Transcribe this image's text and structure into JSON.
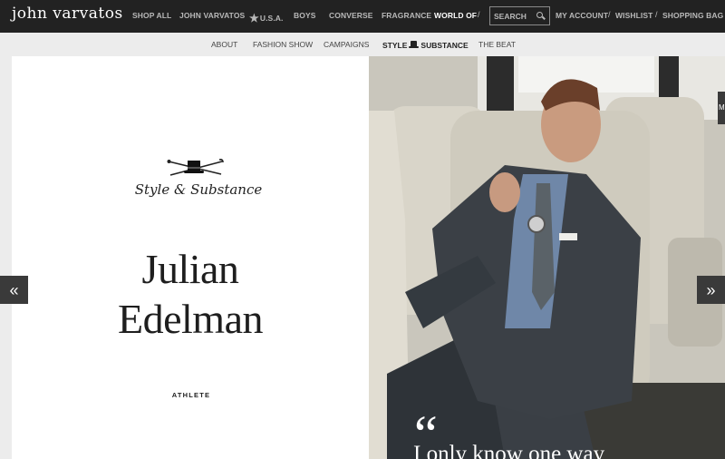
{
  "brand": {
    "logo_text": "john varvatos"
  },
  "topnav": {
    "items": [
      {
        "label": "SHOP ALL"
      },
      {
        "label": "JOHN VARVATOS"
      },
      {
        "label": "U.S.A."
      },
      {
        "label": "BOYS"
      },
      {
        "label": "CONVERSE"
      },
      {
        "label": "FRAGRANCE"
      },
      {
        "label": "WORLD OF"
      }
    ],
    "separator": "/",
    "search_placeholder": "SEARCH",
    "account_label": "MY ACCOUNT",
    "wishlist_label": "WISHLIST",
    "bag_label": "SHOPPING BAG"
  },
  "subnav": {
    "items": [
      {
        "label": "ABOUT"
      },
      {
        "label": "FASHION SHOW"
      },
      {
        "label": "CAMPAIGNS"
      }
    ],
    "style_label": "STYLE",
    "substance_label": "SUBSTANCE",
    "beat_label": "THE BEAT"
  },
  "feature": {
    "series_title": "Style & Substance",
    "first_name": "Julian",
    "last_name": "Edelman",
    "role": "ATHLETE",
    "quote_mark": "“",
    "quote_text": "I only know one way"
  },
  "carousel": {
    "prev_icon": "«",
    "next_icon": "»",
    "side_tab": "M"
  },
  "colors": {
    "topbar_bg": "#222222",
    "page_bg": "#ececec",
    "arrow_bg": "#3a3a3a"
  }
}
